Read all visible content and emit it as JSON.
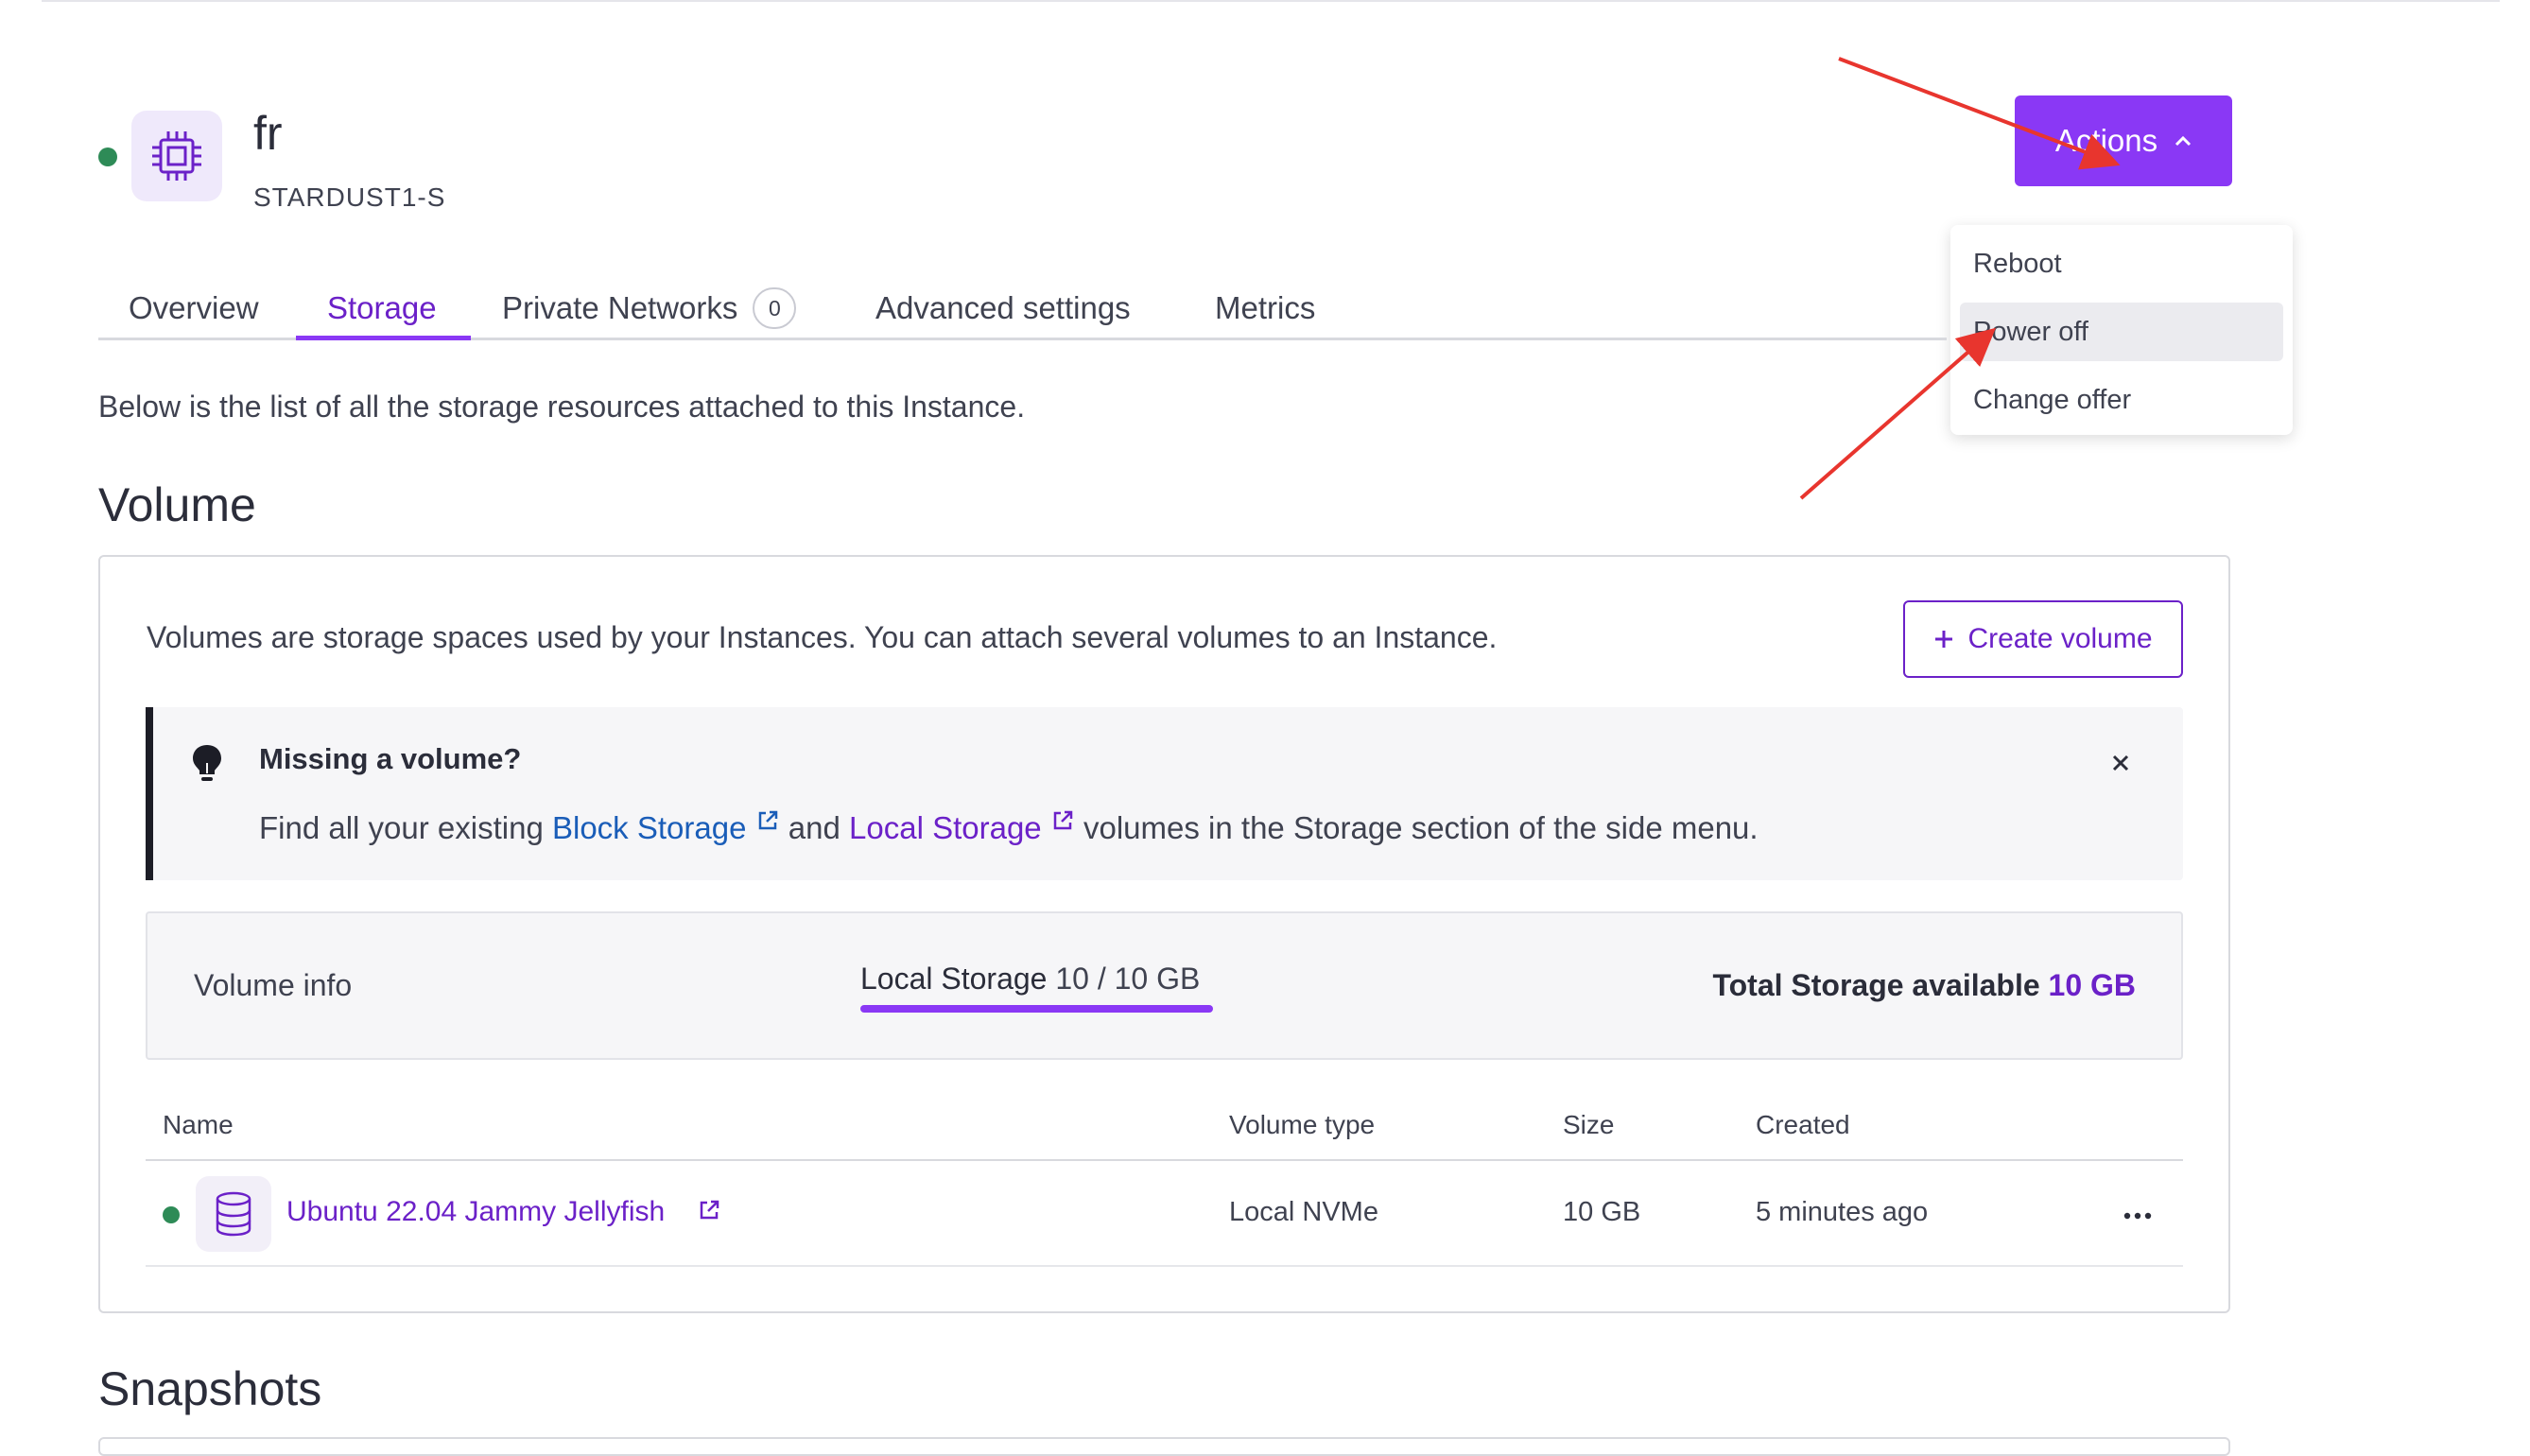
{
  "instance": {
    "name": "fr",
    "type": "STARDUST1-S",
    "status_color": "#2e8b57",
    "icon": "cpu-chip-icon"
  },
  "actions": {
    "label": "Actions",
    "menu": [
      "Reboot",
      "Power off",
      "Change offer"
    ],
    "hovered": "Power off"
  },
  "tabs": [
    {
      "label": "Overview"
    },
    {
      "label": "Storage",
      "active": true
    },
    {
      "label": "Private Networks",
      "badge": "0"
    },
    {
      "label": "Advanced settings"
    },
    {
      "label": "Metrics"
    }
  ],
  "intro": "Below is the list of all the storage resources attached to this Instance.",
  "volume_section": {
    "heading": "Volume",
    "description": "Volumes are storage spaces used by your Instances. You can attach several volumes to an Instance.",
    "create_label": "Create volume"
  },
  "alert": {
    "title": "Missing a volume?",
    "text_1": "Find all your existing ",
    "link_1": "Block Storage",
    "text_2": " and ",
    "link_2": "Local Storage",
    "text_3": " volumes in the Storage section of the side menu."
  },
  "volume_info": {
    "label": "Volume info",
    "local_storage_label": "Local Storage",
    "local_storage_value": "10 / 10 GB",
    "total_label": "Total Storage available",
    "total_value": "10 GB"
  },
  "table": {
    "headers": [
      "Name",
      "Volume type",
      "Size",
      "Created"
    ],
    "rows": [
      {
        "name": "Ubuntu 22.04 Jammy Jellyfish",
        "type": "Local NVMe",
        "size": "10 GB",
        "created": "5 minutes ago"
      }
    ]
  },
  "snapshots_heading": "Snapshots",
  "colors": {
    "accent": "#8a38f5",
    "link": "#6b21c8",
    "status": "#2e8b57"
  }
}
